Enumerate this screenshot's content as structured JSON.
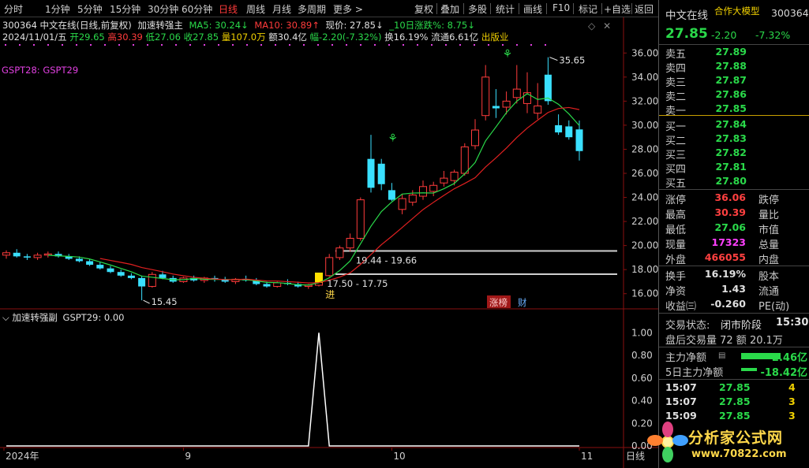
{
  "toolbar": {
    "timeframes": [
      "分时",
      "1分钟",
      "5分钟",
      "15分钟",
      "30分钟",
      "60分钟",
      "日线",
      "周线",
      "月线",
      "多周期",
      "更多 >"
    ],
    "active_timeframe": "日线",
    "tools": [
      "复权",
      "叠加",
      "多股",
      "统计",
      "画线",
      "F10",
      "标记",
      "+自选",
      "返回"
    ]
  },
  "info": {
    "line1_stock": "300364 中文在线(日线,前复权)",
    "indicator_main": "加速转强主",
    "ma5": "MA5: 30.24↓",
    "ma10": "MA10: 30.89↑",
    "current": "现价: 27.85↓",
    "rise10": "_10日涨跌%: 8.75↓",
    "date": "2024/11/01/五",
    "open": "开29.65",
    "high": "高30.39",
    "low": "低27.06",
    "close": "收27.85",
    "volume": "量107.0万",
    "amount": "额30.4亿",
    "amp": "幅-2.20(-7.32%)",
    "turnover": "换16.19%",
    "float": "流通6.61亿",
    "tag": "出版业"
  },
  "gspt_label": "GSPT28: GSPT29",
  "sub_indicator": {
    "name": "加速转强副",
    "value": "GSPT29: 0.00"
  },
  "annotations": {
    "peak": "35.65",
    "low": "15.45",
    "range1": "19.44 - 19.66",
    "range2": "17.50 - 17.75",
    "entry": "进",
    "tag1": "涨榜",
    "tag2": "财"
  },
  "axis": {
    "price_ticks": [
      "36.00",
      "34.00",
      "32.00",
      "30.00",
      "28.00",
      "26.00",
      "24.00",
      "22.00",
      "20.00",
      "18.00",
      "16.00"
    ],
    "sub_ticks": [
      "1.00",
      "0.80",
      "0.60",
      "0.40",
      "0.20",
      "0.00"
    ],
    "date_ticks": [
      "2024年",
      "9",
      "10",
      "11"
    ],
    "period": "日线"
  },
  "chart_data": {
    "type": "candlestick",
    "note_series": [
      "MA5",
      "MA10"
    ],
    "candles": [
      [
        19.2,
        19.6,
        18.9,
        19.4
      ],
      [
        19.4,
        19.7,
        19.0,
        19.1
      ],
      [
        19.1,
        19.3,
        18.8,
        19.0
      ],
      [
        19.0,
        19.4,
        18.8,
        19.2
      ],
      [
        19.2,
        19.5,
        19.0,
        19.3
      ],
      [
        19.3,
        19.5,
        19.0,
        19.1
      ],
      [
        19.1,
        19.3,
        18.8,
        18.9
      ],
      [
        18.9,
        19.1,
        18.6,
        18.7
      ],
      [
        18.7,
        18.9,
        18.3,
        18.4
      ],
      [
        18.4,
        18.6,
        18.0,
        18.1
      ],
      [
        18.1,
        18.3,
        17.7,
        17.8
      ],
      [
        17.8,
        18.0,
        17.4,
        17.5
      ],
      [
        17.5,
        17.7,
        17.2,
        17.3
      ],
      [
        17.3,
        17.5,
        15.45,
        16.6
      ],
      [
        16.6,
        17.8,
        16.5,
        17.6
      ],
      [
        17.6,
        17.9,
        17.2,
        17.3
      ],
      [
        17.3,
        17.5,
        16.9,
        17.0
      ],
      [
        17.0,
        17.4,
        16.9,
        17.3
      ],
      [
        17.3,
        17.5,
        17.0,
        17.1
      ],
      [
        17.1,
        17.4,
        16.9,
        17.3
      ],
      [
        17.3,
        17.5,
        17.0,
        17.2
      ],
      [
        17.2,
        17.4,
        16.9,
        17.0
      ],
      [
        17.0,
        17.3,
        16.8,
        17.2
      ],
      [
        17.2,
        17.5,
        17.0,
        17.1
      ],
      [
        17.1,
        17.3,
        16.7,
        16.8
      ],
      [
        16.8,
        17.0,
        16.5,
        16.6
      ],
      [
        16.6,
        17.0,
        16.5,
        16.9
      ],
      [
        16.9,
        17.2,
        16.7,
        16.8
      ],
      [
        16.8,
        17.0,
        16.5,
        16.6
      ],
      [
        16.6,
        16.8,
        16.4,
        16.7
      ],
      [
        16.7,
        17.75,
        16.6,
        17.5
      ],
      [
        17.5,
        19.3,
        17.4,
        19.0
      ],
      [
        19.0,
        20.0,
        18.8,
        19.8
      ],
      [
        19.8,
        21.0,
        19.5,
        20.6
      ],
      [
        20.6,
        24.0,
        20.4,
        23.8
      ],
      [
        27.2,
        29.2,
        24.4,
        24.8
      ],
      [
        26.8,
        27.2,
        24.6,
        25.1
      ],
      [
        24.6,
        25.2,
        23.7,
        23.8
      ],
      [
        23.0,
        24.3,
        22.6,
        23.9
      ],
      [
        23.6,
        24.6,
        23.3,
        24.2
      ],
      [
        24.1,
        25.4,
        23.8,
        24.9
      ],
      [
        24.5,
        25.3,
        24.1,
        25.0
      ],
      [
        25.2,
        26.2,
        24.9,
        25.6
      ],
      [
        25.4,
        26.3,
        25.0,
        26.1
      ],
      [
        26.0,
        28.5,
        25.8,
        28.2
      ],
      [
        28.3,
        30.5,
        28.0,
        29.6
      ],
      [
        30.8,
        35.0,
        30.4,
        34.0
      ],
      [
        31.6,
        33.0,
        30.6,
        31.4
      ],
      [
        31.5,
        32.8,
        30.9,
        32.0
      ],
      [
        32.3,
        35.0,
        31.8,
        33.0
      ],
      [
        31.8,
        34.4,
        31.0,
        32.7
      ],
      [
        31.0,
        33.5,
        30.5,
        31.6
      ],
      [
        34.2,
        35.65,
        31.7,
        32.0
      ],
      [
        30.0,
        30.9,
        29.2,
        29.4
      ],
      [
        29.9,
        30.4,
        28.8,
        29.0
      ],
      [
        29.65,
        30.39,
        27.06,
        27.85
      ]
    ],
    "sub_values": [
      0,
      0,
      0,
      0,
      0,
      0,
      0,
      0,
      0,
      0,
      0,
      0,
      0,
      0,
      0,
      0,
      0,
      0,
      0,
      0,
      0,
      0,
      0,
      0,
      0,
      0,
      0,
      0,
      0,
      0,
      1,
      0,
      0,
      0,
      0,
      0,
      0,
      0,
      0,
      0,
      0,
      0,
      0,
      0,
      0,
      0,
      0,
      0,
      0,
      0,
      0,
      0,
      0,
      0,
      0,
      0
    ],
    "ylim": [
      15,
      37
    ],
    "sub_ylim": [
      0,
      1.1
    ],
    "colors": {
      "up": "#ff3b3b",
      "down": "#3ae0ff",
      "ma5": "#2ad94a",
      "ma10": "#e02020",
      "bg": "#000000"
    }
  },
  "panel": {
    "title": "中文在线",
    "badge": "合作大模型",
    "code": "300364",
    "price": "27.85",
    "change": "-2.20",
    "pct": "-7.32%",
    "asks": [
      {
        "label": "卖五",
        "price": "27.89"
      },
      {
        "label": "卖四",
        "price": "27.88"
      },
      {
        "label": "卖三",
        "price": "27.87"
      },
      {
        "label": "卖二",
        "price": "27.86"
      },
      {
        "label": "卖一",
        "price": "27.85"
      }
    ],
    "bids": [
      {
        "label": "买一",
        "price": "27.84"
      },
      {
        "label": "买二",
        "price": "27.83"
      },
      {
        "label": "买三",
        "price": "27.82"
      },
      {
        "label": "买四",
        "price": "27.81"
      },
      {
        "label": "买五",
        "price": "27.80"
      }
    ],
    "stats": [
      {
        "l": "涨停",
        "v": "36.06",
        "c": "#ff4040",
        "r": "跌停"
      },
      {
        "l": "最高",
        "v": "30.39",
        "c": "#ff4040",
        "r": "量比"
      },
      {
        "l": "最低",
        "v": "27.06",
        "c": "#2ad94a",
        "r": "市值"
      },
      {
        "l": "现量",
        "v": "17323",
        "c": "#ff40ff",
        "r": "总量"
      },
      {
        "l": "外盘",
        "v": "466055",
        "c": "#ff4040",
        "r": "内盘"
      }
    ],
    "stats2": [
      {
        "l": "换手",
        "v": "16.19%",
        "c": "#e0e0e0",
        "r": "股本"
      },
      {
        "l": "净资",
        "v": "1.43",
        "c": "#e0e0e0",
        "r": "流通"
      },
      {
        "l": "收益㈢",
        "v": "-0.260",
        "c": "#e0e0e0",
        "r": "PE(动)"
      }
    ],
    "trade_state_label": "交易状态:",
    "trade_state": "闭市阶段",
    "trade_time": "15:30",
    "after_vol": "盘后交易量 72 额 20.1万",
    "fund_label": "主力净额",
    "fund_value": "-2.46亿",
    "fund5_label": "5日主力净额",
    "fund5_value": "-18.42亿",
    "ticks": [
      {
        "t": "15:07",
        "p": "27.85",
        "v": "4"
      },
      {
        "t": "15:07",
        "p": "27.85",
        "v": "3"
      },
      {
        "t": "15:09",
        "p": "27.85",
        "v": "3"
      }
    ]
  },
  "logo": {
    "name": "分析家公式网",
    "url": "www.70822.com"
  }
}
